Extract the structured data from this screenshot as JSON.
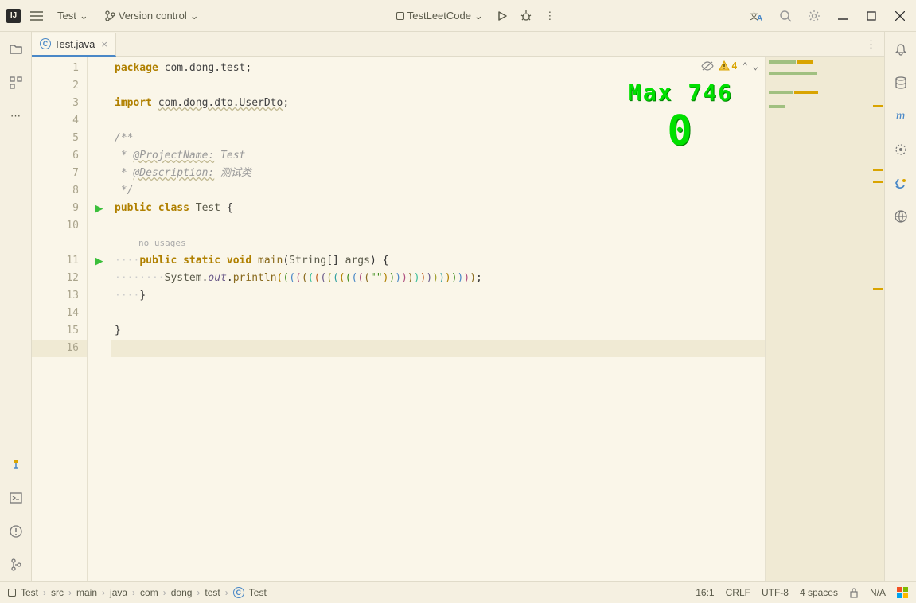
{
  "titlebar": {
    "project": "Test",
    "vcs": "Version control",
    "run_config": "TestLeetCode"
  },
  "tab": {
    "filename": "Test.java"
  },
  "inspections": {
    "warning_count": "4"
  },
  "overlay": {
    "line1": "Max 746",
    "line2": "0"
  },
  "code": {
    "lines": [
      "1",
      "2",
      "3",
      "4",
      "5",
      "6",
      "7",
      "8",
      "9",
      "10",
      "11",
      "12",
      "13",
      "14",
      "15",
      "16"
    ],
    "l1_kw": "package ",
    "l1_pkg": "com.dong.test",
    "l1_end": ";",
    "l3_kw": "import ",
    "l3_pkg": "com.dong.dto.UserDto",
    "l3_end": ";",
    "l5": "/**",
    "l6_pre": " * ",
    "l6_tag": "@ProjectName:",
    "l6_val": " Test",
    "l7_pre": " * ",
    "l7_tag": "@Description:",
    "l7_val": " 测试类",
    "l8": " */",
    "l9_kw1": "public class ",
    "l9_cls": "Test",
    "l9_b": " {",
    "inlay": "no usages",
    "l11_ind": "    ",
    "l11_kw": "public static void ",
    "l11_mth": "main",
    "l11_p1": "(",
    "l11_type": "String",
    "l11_arr": "[] ",
    "l11_arg": "args",
    "l11_p2": ") {",
    "l12_ind": "        ",
    "l12_sys": "System",
    "l12_dot1": ".",
    "l12_out": "out",
    "l12_dot2": ".",
    "l12_println": "println",
    "l12_str": "\"\"",
    "l12_end": ";",
    "l13": "    }",
    "l15": "}"
  },
  "breadcrumbs": [
    "Test",
    "src",
    "main",
    "java",
    "com",
    "dong",
    "test",
    "Test"
  ],
  "status": {
    "pos": "16:1",
    "eol": "CRLF",
    "enc": "UTF-8",
    "indent": "4 spaces",
    "git": "N/A"
  }
}
